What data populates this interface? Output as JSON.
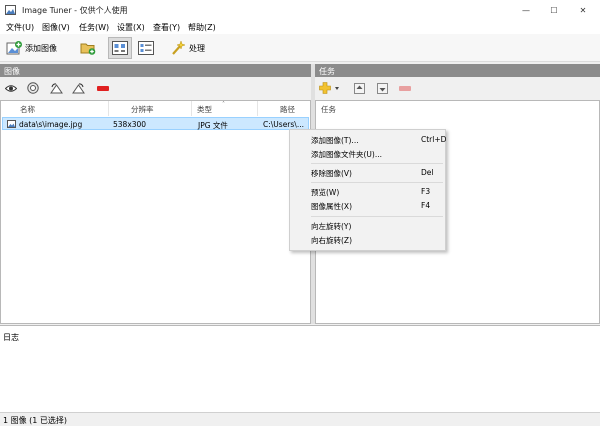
{
  "window": {
    "title": "Image Tuner - 仅供个人使用",
    "minimize_glyph": "—",
    "maximize_glyph": "☐",
    "close_glyph": "✕"
  },
  "menu": [
    "文件(U)",
    "图像(V)",
    "任务(W)",
    "设置(X)",
    "查看(Y)",
    "帮助(Z)"
  ],
  "toolbar": {
    "add_image_label": "添加图像",
    "process_label": "处理"
  },
  "images_panel": {
    "title": "图像",
    "columns": [
      "名称",
      "分辨率",
      "类型",
      "路径"
    ],
    "rows": [
      {
        "name": "data\\s\\image.jpg",
        "resolution": "538x300",
        "type": "JPG 文件",
        "path": "C:\\Users\\..."
      }
    ]
  },
  "tasks_panel": {
    "title": "任务",
    "column": "任务"
  },
  "context_menu": [
    {
      "label": "添加图像(T)...",
      "shortcut": "Ctrl+D"
    },
    {
      "label": "添加图像文件夹(U)...",
      "shortcut": ""
    },
    {
      "label": "移除图像(V)",
      "shortcut": "Del"
    },
    {
      "label": "预览(W)",
      "shortcut": "F3"
    },
    {
      "label": "图像属性(X)",
      "shortcut": "F4"
    },
    {
      "label": "向左旋转(Y)",
      "shortcut": ""
    },
    {
      "label": "向右旋转(Z)",
      "shortcut": ""
    }
  ],
  "log": {
    "title": "日志"
  },
  "status": {
    "text": "1 图像 (1 已选择)"
  },
  "colors": {
    "accent": "#cce8ff",
    "panel_header": "#8c8c8c",
    "remove": "#e02020"
  }
}
